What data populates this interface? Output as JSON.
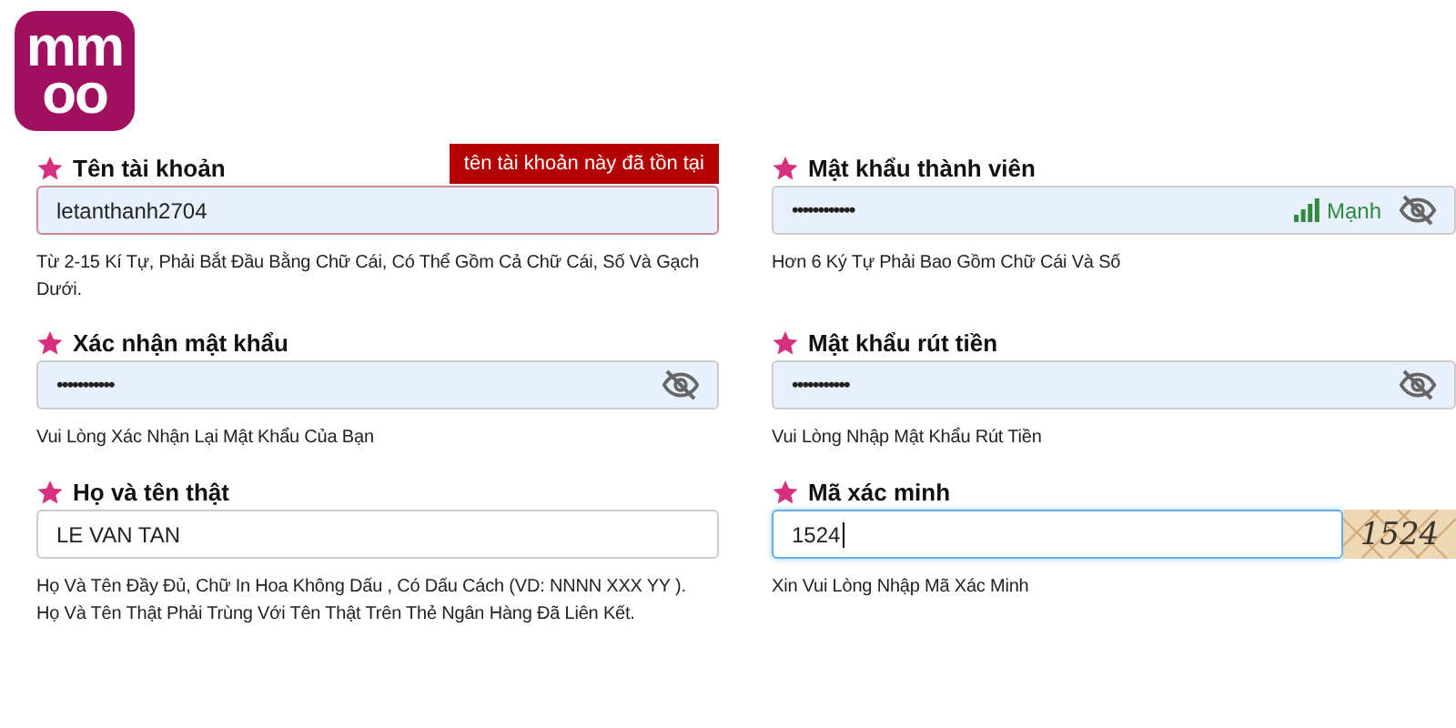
{
  "logo": {
    "lines": [
      "mm",
      "oo"
    ]
  },
  "fields": [
    {
      "kind": "text",
      "label": "Tên tài khoản",
      "required": true,
      "value": "letanthanh2704",
      "error": "tên tài khoản này đã tồn tại",
      "hint": "Từ 2-15 Kí Tự, Phải Bắt Đầu Bằng Chữ Cái, Có Thể Gồm Cả Chữ Cái, Số Và Gạch Dưới.",
      "autofilled": true,
      "focused": false
    },
    {
      "kind": "password",
      "label": "Mật khẩu thành viên",
      "required": true,
      "value": "••••••••••••",
      "strength": "Mạnh",
      "hint": "Hơn 6 Ký Tự Phải Bao Gồm Chữ Cái Và Số",
      "autofilled": true,
      "focused": false
    },
    {
      "kind": "password",
      "label": "Xác nhận mật khẩu",
      "required": true,
      "value": "•••••••••••",
      "hint": "Vui Lòng Xác Nhận Lại Mật Khẩu Của Bạn",
      "autofilled": true,
      "focused": false
    },
    {
      "kind": "password",
      "label": "Mật khẩu rút tiền",
      "required": true,
      "value": "•••••••••••",
      "hint": "Vui Lòng Nhập Mật Khẩu Rút Tiền",
      "autofilled": true,
      "focused": false
    },
    {
      "kind": "text",
      "label": "Họ và tên thật",
      "required": true,
      "value": "LE VAN TAN",
      "hint": "Họ Và Tên Đầy Đủ, Chữ In Hoa Không Dấu , Có Dấu Cách (VD: NNNN XXX YY ). Họ Và Tên Thật Phải Trùng Với Tên Thật Trên Thẻ Ngân Hàng Đã Liên Kết.",
      "autofilled": false,
      "focused": false
    },
    {
      "kind": "captcha",
      "label": "Mã xác minh",
      "required": true,
      "value": "1524",
      "captcha": "1524",
      "hint": "Xin Vui Lòng Nhập Mã Xác Minh",
      "autofilled": false,
      "focused": true
    }
  ]
}
